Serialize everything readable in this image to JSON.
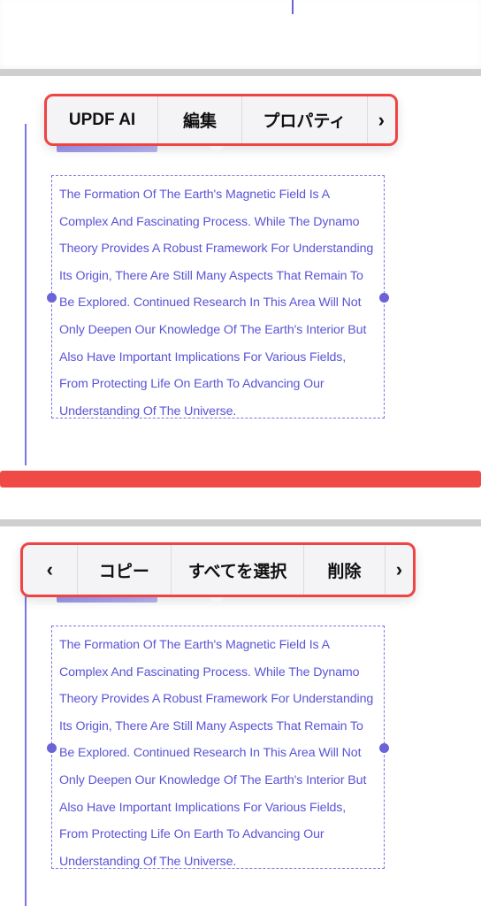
{
  "toolbar1": {
    "items": [
      "UPDF AI",
      "編集",
      "プロパティ"
    ],
    "next_arrow": "›"
  },
  "toolbar2": {
    "prev_arrow": "‹",
    "items": [
      "コピー",
      "すべてを選択",
      "削除"
    ],
    "next_arrow": "›"
  },
  "text_block": {
    "lines": [
      "The Formation Of The Earth's Magnetic Field Is A",
      "Complex And Fascinating Process. While The Dynamo",
      "Theory Provides A Robust Framework For Understanding",
      "Its Origin, There Are Still Many Aspects That Remain To",
      "Be Explored. Continued Research In This Area Will Not",
      "Only Deepen Our Knowledge Of The Earth's Interior But",
      "Also Have Important Implications For Various Fields,",
      "From Protecting Life On Earth To Advancing Our",
      "Understanding Of The Universe."
    ]
  },
  "colors": {
    "accent": "#6c63d8",
    "annotation_red": "#ef4444",
    "text_purple": "#5a54d6"
  }
}
